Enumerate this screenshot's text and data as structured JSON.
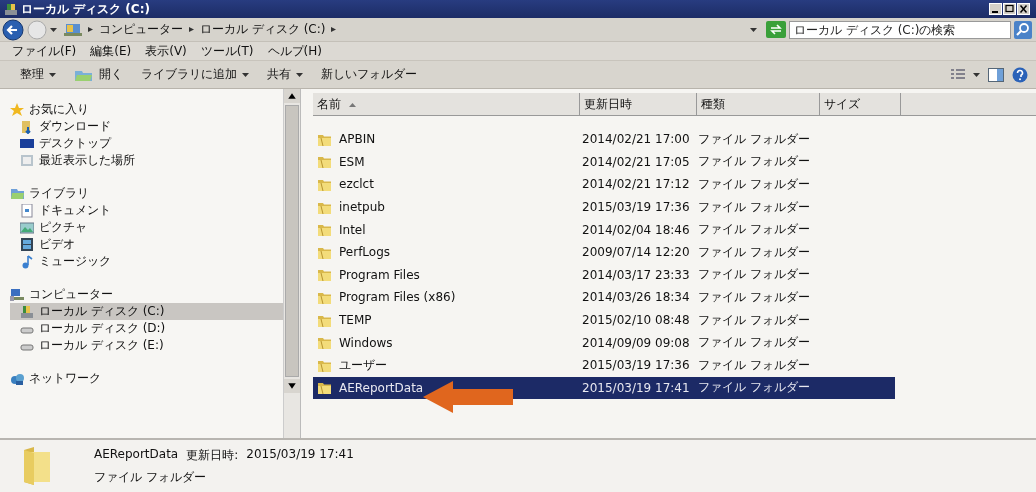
{
  "window": {
    "title": "ローカル ディスク (C:)"
  },
  "address_bar": {
    "breadcrumbs": [
      "コンピューター",
      "ローカル ディスク (C:)"
    ],
    "search": {
      "placeholder": "ローカル ディスク (C:)の検索"
    }
  },
  "menu_bar": [
    "ファイル(F)",
    "編集(E)",
    "表示(V)",
    "ツール(T)",
    "ヘルプ(H)"
  ],
  "toolbar": [
    {
      "label": "整理",
      "dropdown": true
    },
    {
      "label": "開く",
      "dropdown": false
    },
    {
      "label": "ライブラリに追加",
      "dropdown": true
    },
    {
      "label": "共有",
      "dropdown": true
    },
    {
      "label": "新しいフォルダー",
      "dropdown": false
    }
  ],
  "sidebar": {
    "items": [
      {
        "label": "お気に入り",
        "selected": false,
        "children": [
          {
            "label": "ダウンロード",
            "selected": false
          },
          {
            "label": "デスクトップ",
            "selected": false
          },
          {
            "label": "最近表示した場所",
            "selected": false
          }
        ]
      },
      {
        "label": "ライブラリ",
        "selected": false,
        "children": [
          {
            "label": "ドキュメント",
            "selected": false
          },
          {
            "label": "ピクチャ",
            "selected": false
          },
          {
            "label": "ビデオ",
            "selected": false
          },
          {
            "label": "ミュージック",
            "selected": false
          }
        ]
      },
      {
        "label": "コンピューター",
        "selected": false,
        "children": [
          {
            "label": "ローカル ディスク (C:)",
            "selected": true
          },
          {
            "label": "ローカル ディスク (D:)",
            "selected": false
          },
          {
            "label": "ローカル ディスク (E:)",
            "selected": false
          }
        ]
      },
      {
        "label": "ネットワーク",
        "selected": false
      }
    ]
  },
  "table": {
    "columns": [
      {
        "label": "名前",
        "sorted": true
      },
      {
        "label": "更新日時",
        "sorted": false
      },
      {
        "label": "種類",
        "sorted": false
      },
      {
        "label": "サイズ",
        "sorted": false
      }
    ],
    "rows": [
      {
        "name": "APBIN",
        "modified": "2014/02/21 17:00",
        "type": "ファイル フォルダー",
        "selected": false
      },
      {
        "name": "ESM",
        "modified": "2014/02/21 17:05",
        "type": "ファイル フォルダー",
        "selected": false
      },
      {
        "name": "ezclct",
        "modified": "2014/02/21 17:12",
        "type": "ファイル フォルダー",
        "selected": false
      },
      {
        "name": "inetpub",
        "modified": "2015/03/19 17:36",
        "type": "ファイル フォルダー",
        "selected": false
      },
      {
        "name": "Intel",
        "modified": "2014/02/04 18:46",
        "type": "ファイル フォルダー",
        "selected": false
      },
      {
        "name": "PerfLogs",
        "modified": "2009/07/14 12:20",
        "type": "ファイル フォルダー",
        "selected": false
      },
      {
        "name": "Program Files",
        "modified": "2014/03/17 23:33",
        "type": "ファイル フォルダー",
        "selected": false
      },
      {
        "name": "Program Files (x86)",
        "modified": "2014/03/26 18:34",
        "type": "ファイル フォルダー",
        "selected": false
      },
      {
        "name": "TEMP",
        "modified": "2015/02/10 08:48",
        "type": "ファイル フォルダー",
        "selected": false
      },
      {
        "name": "Windows",
        "modified": "2014/09/09 09:08",
        "type": "ファイル フォルダー",
        "selected": false
      },
      {
        "name": "ユーザー",
        "modified": "2015/03/19 17:36",
        "type": "ファイル フォルダー",
        "selected": false
      },
      {
        "name": "AEReportData",
        "modified": "2015/03/19 17:41",
        "type": "ファイル フォルダー",
        "selected": true
      }
    ]
  },
  "details_pane": {
    "name": "AEReportData",
    "modified_label": "更新日時:",
    "modified": "2015/03/19 17:41",
    "type": "ファイル フォルダー"
  }
}
